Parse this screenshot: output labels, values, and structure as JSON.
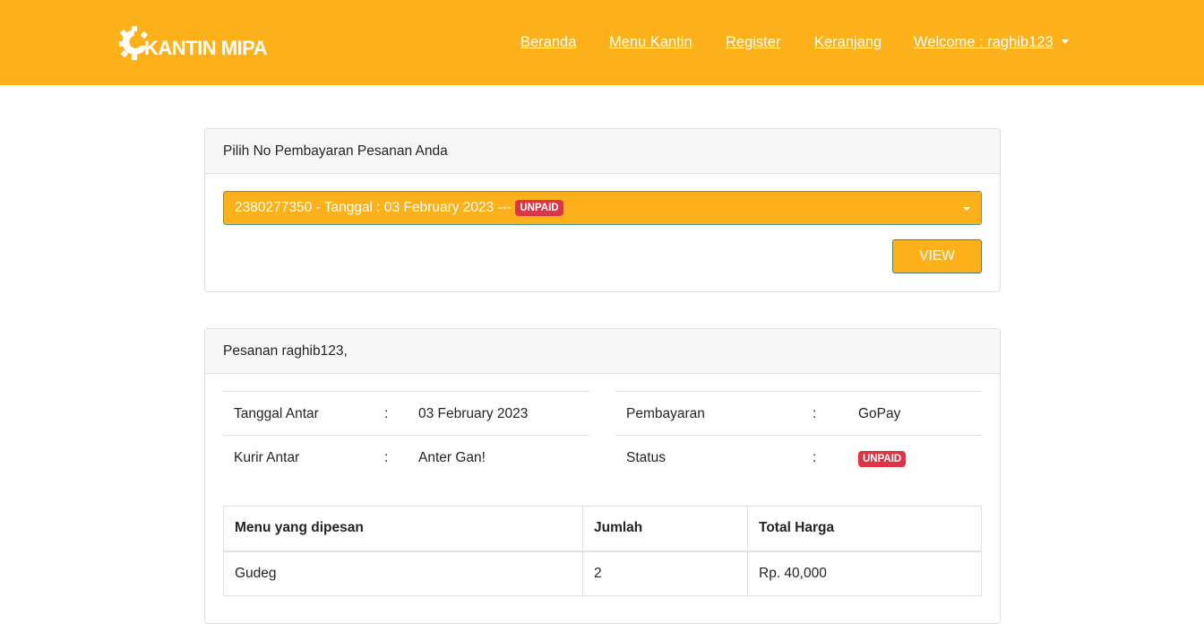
{
  "nav": {
    "brand": "KANTIN MIPA",
    "links": [
      "Beranda",
      "Menu Kantin",
      "Register",
      "Keranjang"
    ],
    "welcome": "Welcome : raghib123"
  },
  "payment_card": {
    "header": "Pilih No Pembayaran Pesanan Anda",
    "selected_option": "2380277350 - Tanggal : 03 February 2023 ---",
    "selected_badge": "UNPAID",
    "view_button": "VIEW"
  },
  "order_card": {
    "header": "Pesanan raghib123,",
    "left_info": [
      {
        "label": "Tanggal Antar",
        "sep": ":",
        "value": "03 February 2023"
      },
      {
        "label": "Kurir Antar",
        "sep": ":",
        "value": "Anter Gan!"
      }
    ],
    "right_info": [
      {
        "label": "Pembayaran",
        "sep": ":",
        "value": "GoPay"
      },
      {
        "label": "Status",
        "sep": ":",
        "value": "UNPAID"
      }
    ],
    "table": {
      "headers": [
        "Menu yang dipesan",
        "Jumlah",
        "Total Harga"
      ],
      "rows": [
        [
          "Gudeg",
          "2",
          "Rp. 40,000"
        ]
      ]
    }
  },
  "colors": {
    "primary": "#fcb11a",
    "danger": "#dc3545"
  }
}
